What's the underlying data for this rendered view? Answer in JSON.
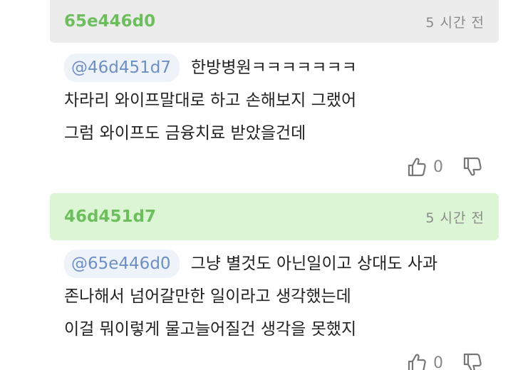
{
  "comments": [
    {
      "author": "65e446d0",
      "time": "5 시간 전",
      "mention": "@46d451d7",
      "lines": [
        "한방병원ㅋㅋㅋㅋㅋㅋㅋ",
        "차라리 와이프말대로 하고 손해보지 그랬어",
        "그럼 와이프도 금융치료 받았을건데"
      ],
      "like_count": "0"
    },
    {
      "author": "46d451d7",
      "time": "5 시간 전",
      "mention": "@65e446d0",
      "lines": [
        "그냥 별것도 아닌일이고 상대도 사과",
        "존나해서 넘어갈만한 일이라고 생각했는데",
        "이걸 뭐이렇게 물고늘어질건 생각을 못했지"
      ],
      "like_count": "0"
    }
  ],
  "icons": {
    "like": "thumbs-up-icon",
    "dislike": "thumbs-down-icon"
  },
  "colors": {
    "author": "#6cbf5c",
    "highlight_header": "#dcf5d4",
    "normal_header": "#ececec",
    "mention": "#6d8fc4"
  }
}
